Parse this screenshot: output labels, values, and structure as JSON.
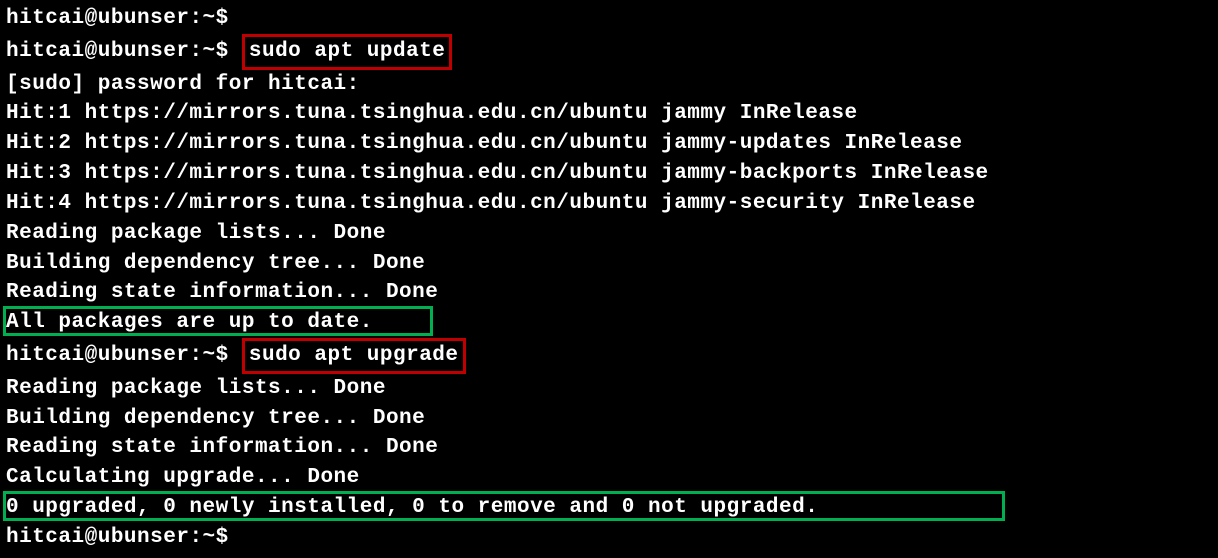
{
  "prompt": {
    "user_host": "hitcai@ubunser",
    "path": "~",
    "symbol": "$"
  },
  "commands": {
    "update": "sudo apt update",
    "upgrade": "sudo apt upgrade"
  },
  "lines": {
    "sudo_prompt": "[sudo] password for hitcai:",
    "hit1": "Hit:1 https://mirrors.tuna.tsinghua.edu.cn/ubuntu jammy InRelease",
    "hit2": "Hit:2 https://mirrors.tuna.tsinghua.edu.cn/ubuntu jammy-updates InRelease",
    "hit3": "Hit:3 https://mirrors.tuna.tsinghua.edu.cn/ubuntu jammy-backports InRelease",
    "hit4": "Hit:4 https://mirrors.tuna.tsinghua.edu.cn/ubuntu jammy-security InRelease",
    "reading_pkg": "Reading package lists... Done",
    "building_dep": "Building dependency tree... Done",
    "reading_state": "Reading state information... Done",
    "all_up_to_date": "All packages are up to date.",
    "calculating": "Calculating upgrade... Done",
    "upgrade_summary": "0 upgraded, 0 newly installed, 0 to remove and 0 not upgraded."
  }
}
